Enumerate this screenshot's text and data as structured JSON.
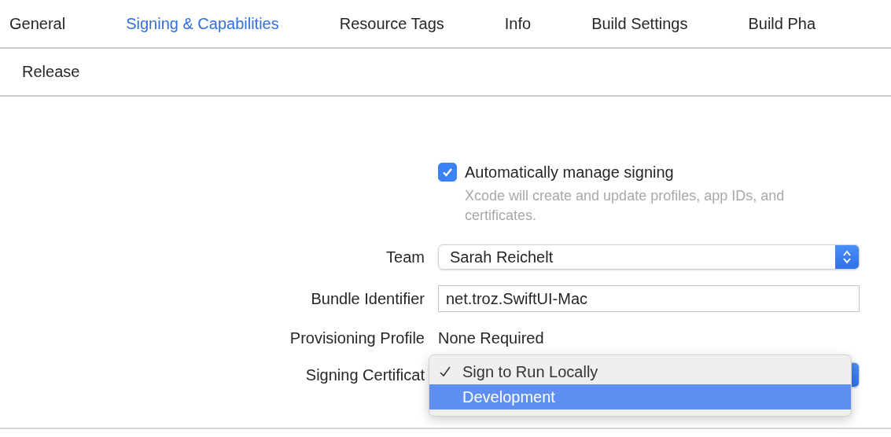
{
  "tabs": [
    {
      "label": "General",
      "selected": false
    },
    {
      "label": "Signing & Capabilities",
      "selected": true
    },
    {
      "label": "Resource Tags",
      "selected": false
    },
    {
      "label": "Info",
      "selected": false
    },
    {
      "label": "Build Settings",
      "selected": false
    },
    {
      "label": "Build Pha",
      "selected": false
    }
  ],
  "configuration": "Release",
  "auto_signing": {
    "label": "Automatically manage signing",
    "checked": true,
    "hint": "Xcode will create and update profiles, app IDs, and certificates."
  },
  "team": {
    "label": "Team",
    "value": "Sarah Reichelt"
  },
  "bundle_identifier": {
    "label": "Bundle Identifier",
    "value": "net.troz.SwiftUI-Mac"
  },
  "provisioning_profile": {
    "label": "Provisioning Profile",
    "value": "None Required"
  },
  "signing_certificate": {
    "label": "Signing Certificat",
    "options": [
      {
        "label": "Sign to Run Locally",
        "selected": true,
        "highlighted": false
      },
      {
        "label": "Development",
        "selected": false,
        "highlighted": true
      }
    ]
  }
}
